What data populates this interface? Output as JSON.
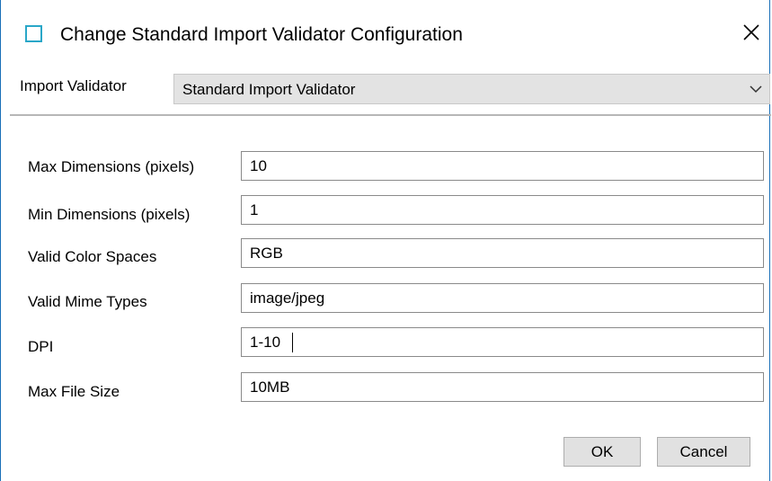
{
  "window": {
    "title": "Change Standard Import Validator Configuration",
    "icon": "window-square-icon",
    "close_icon": "close-icon"
  },
  "import_validator": {
    "label": "Import Validator",
    "selected": "Standard Import Validator",
    "chevron_icon": "chevron-down-icon"
  },
  "fields": [
    {
      "label": "Max Dimensions (pixels)",
      "value": "10"
    },
    {
      "label": "Min Dimensions (pixels)",
      "value": "1"
    },
    {
      "label": "Valid Color Spaces",
      "value": "RGB"
    },
    {
      "label": "Valid Mime Types",
      "value": "image/jpeg"
    },
    {
      "label": "DPI",
      "value": "1-10"
    },
    {
      "label": "Max File Size",
      "value": "10MB"
    }
  ],
  "buttons": {
    "ok": "OK",
    "cancel": "Cancel"
  },
  "colors": {
    "icon_accent": "#2aa7c8",
    "window_border": "#1a6fb8",
    "select_bg": "#e3e3e3",
    "button_bg": "#e1e1e1"
  }
}
